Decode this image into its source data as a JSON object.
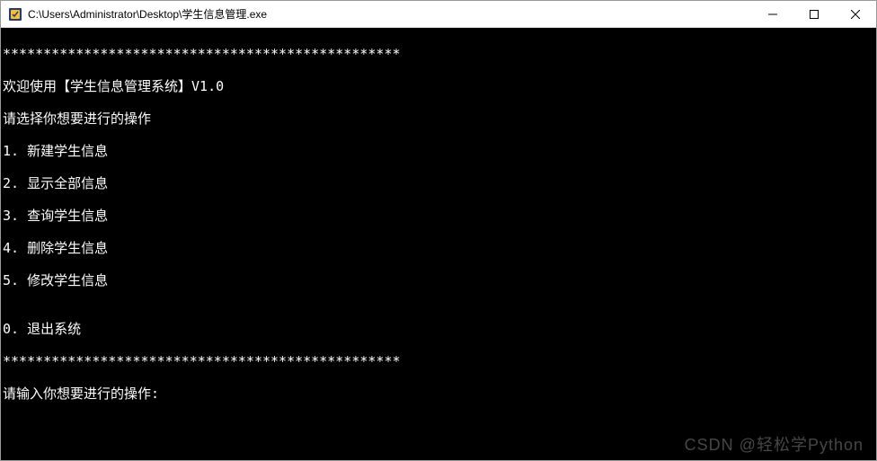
{
  "window": {
    "title": "C:\\Users\\Administrator\\Desktop\\学生信息管理.exe"
  },
  "console": {
    "separator1": "*************************************************",
    "welcome": "欢迎使用【学生信息管理系统】V1.0",
    "prompt_select": "请选择你想要进行的操作",
    "menu": [
      "1. 新建学生信息",
      "2. 显示全部信息",
      "3. 查询学生信息",
      "4. 删除学生信息",
      "5. 修改学生信息"
    ],
    "blank": "",
    "exit_option": "0. 退出系统",
    "separator2": "*************************************************",
    "input_prompt": "请输入你想要进行的操作:"
  },
  "watermark": "CSDN @轻松学Python"
}
